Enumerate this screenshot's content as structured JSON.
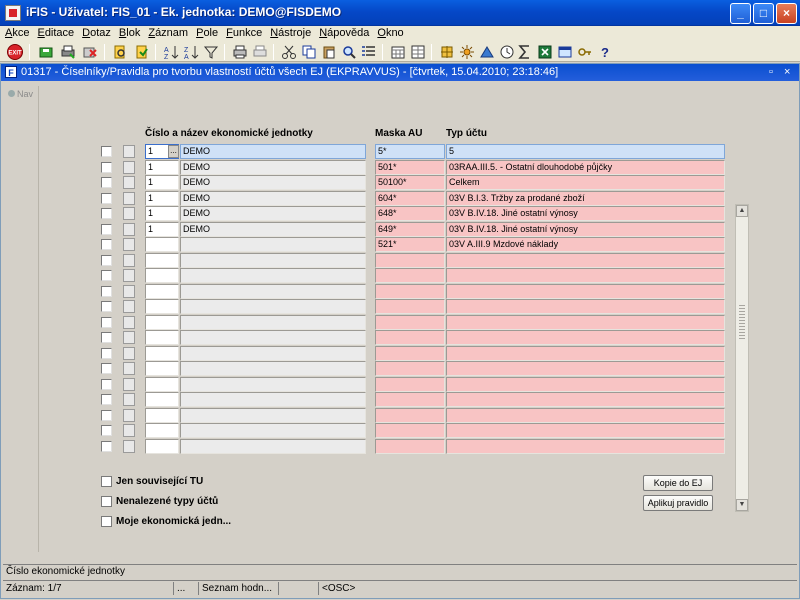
{
  "window": {
    "title": "iFIS - Uživatel: FIS_01 - Ek. jednotka: DEMO@FISDEMO",
    "minimize": "_",
    "maximize": "□",
    "close": "×"
  },
  "menu": [
    "Akce",
    "Editace",
    "Dotaz",
    "Blok",
    "Záznam",
    "Pole",
    "Funkce",
    "Nástroje",
    "Nápověda",
    "Okno"
  ],
  "toolbar_icons": [
    "exit-icon",
    "save-icon",
    "print-icon",
    "clear-icon",
    "enter-query-icon",
    "execute-query-icon",
    "sort-asc-icon",
    "sort-desc-icon",
    "filter-icon",
    "print-report-icon",
    "export-icon",
    "cut-icon",
    "copy-icon",
    "paste-icon",
    "find-icon",
    "list-icon",
    "calendar-icon",
    "settings-icon",
    "triangle-icon",
    "clock-icon",
    "sum-icon",
    "excel-icon",
    "window-icon",
    "key-icon",
    "help-icon"
  ],
  "inner_window": {
    "title": "01317 - Číselníky/Pravidla pro tvorbu vlastností účtů všech EJ (EKPRAVVUS) - [čtvrtek, 15.04.2010; 23:18:46]",
    "restore": "▫",
    "close": "×"
  },
  "nav": {
    "label": "Nav"
  },
  "grid": {
    "headers": {
      "unit": "Číslo a název ekonomické jednotky",
      "mask": "Maska AU",
      "type": "Typ účtu"
    },
    "rows": [
      {
        "num": "1",
        "name": "DEMO",
        "mask": "5*",
        "type": "5"
      },
      {
        "num": "1",
        "name": "DEMO",
        "mask": "501*",
        "type": "03RAA.III.5. - Ostatní dlouhodobé půjčky"
      },
      {
        "num": "1",
        "name": "DEMO",
        "mask": "50100*",
        "type": "Celkem"
      },
      {
        "num": "1",
        "name": "DEMO",
        "mask": "604*",
        "type": "03V B.I.3. Tržby za prodané zboží"
      },
      {
        "num": "1",
        "name": "DEMO",
        "mask": "648*",
        "type": "03V B.IV.18. Jiné ostatní výnosy"
      },
      {
        "num": "1",
        "name": "DEMO",
        "mask": "649*",
        "type": "03V B.IV.18. Jiné ostatní výnosy"
      },
      {
        "num": "",
        "name": "",
        "mask": "521*",
        "type": "03V A.III.9 Mzdové náklady"
      },
      {
        "num": "",
        "name": "",
        "mask": "",
        "type": ""
      },
      {
        "num": "",
        "name": "",
        "mask": "",
        "type": ""
      },
      {
        "num": "",
        "name": "",
        "mask": "",
        "type": ""
      },
      {
        "num": "",
        "name": "",
        "mask": "",
        "type": ""
      },
      {
        "num": "",
        "name": "",
        "mask": "",
        "type": ""
      },
      {
        "num": "",
        "name": "",
        "mask": "",
        "type": ""
      },
      {
        "num": "",
        "name": "",
        "mask": "",
        "type": ""
      },
      {
        "num": "",
        "name": "",
        "mask": "",
        "type": ""
      },
      {
        "num": "",
        "name": "",
        "mask": "",
        "type": ""
      },
      {
        "num": "",
        "name": "",
        "mask": "",
        "type": ""
      },
      {
        "num": "",
        "name": "",
        "mask": "",
        "type": ""
      },
      {
        "num": "",
        "name": "",
        "mask": "",
        "type": ""
      },
      {
        "num": "",
        "name": "",
        "mask": "",
        "type": ""
      }
    ],
    "lov_button": "..."
  },
  "options": {
    "related_tu": "Jen související TU",
    "not_found_types": "Nenalezené  typy účtů",
    "my_unit": "Moje ekonomická jedn..."
  },
  "buttons": {
    "copy_to_ej": "Kopie do EJ",
    "apply_rule": "Aplikuj pravidlo"
  },
  "status": {
    "hint": "Číslo ekonomické jednotky",
    "record": "Záznam: 1/7",
    "seg2": "...",
    "seg3": "Seznam hodn...",
    "seg4": "<OSC>"
  }
}
